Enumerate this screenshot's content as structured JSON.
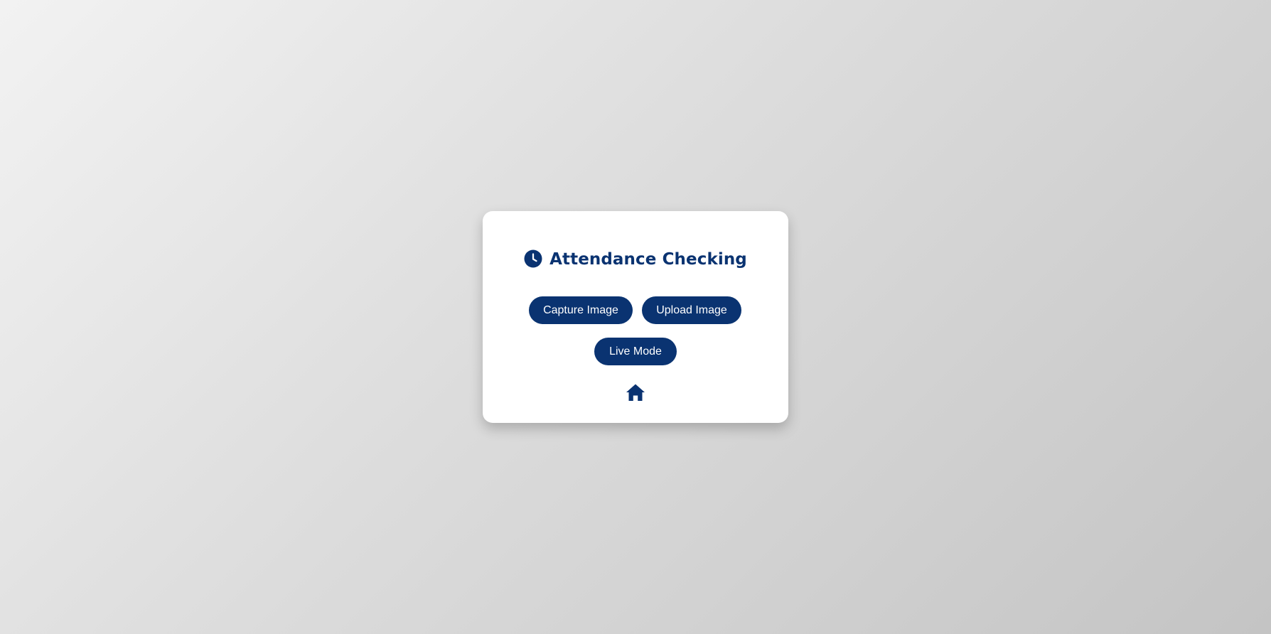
{
  "header": {
    "title": "Attendance Checking",
    "title_icon": "clock-icon"
  },
  "actions": {
    "capture_label": "Capture Image",
    "upload_label": "Upload Image",
    "live_label": "Live Mode"
  },
  "footer": {
    "home_icon": "home-icon"
  },
  "colors": {
    "primary": "#0a3371",
    "card_background": "#ffffff",
    "button_text": "#ffffff"
  }
}
